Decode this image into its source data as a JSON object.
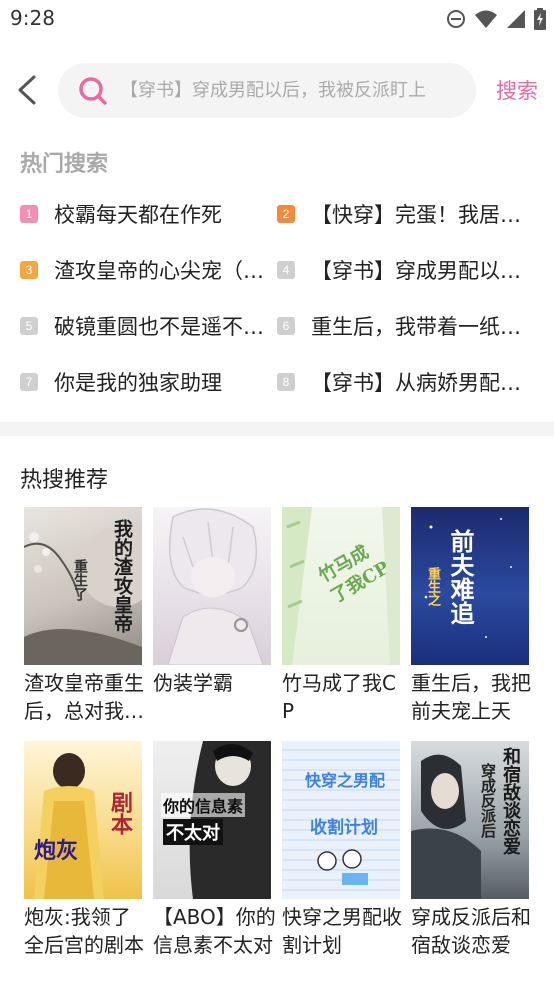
{
  "status_bar": {
    "time": "9:28"
  },
  "search": {
    "placeholder": "【穿书】穿成男配以后，我被反派盯上",
    "submit_label": "搜索"
  },
  "hot_search": {
    "title": "热门搜索",
    "items": [
      {
        "rank": "1",
        "text": "校霸每天都在作死",
        "color": "#f06292"
      },
      {
        "rank": "2",
        "text": "【快穿】完蛋！我居然被盯上了",
        "color": "#f08a3c"
      },
      {
        "rank": "3",
        "text": "渣攻皇帝的心尖宠（重生）",
        "color": "#f5a73b"
      },
      {
        "rank": "4",
        "text": "【穿书】穿成男配以后，我被反派盯上",
        "color": "#c8c8c8"
      },
      {
        "rank": "5",
        "text": "破镜重圆也不是遥不可及",
        "color": "#c8c8c8"
      },
      {
        "rank": "6",
        "text": "重生后，我带着一纸婚书",
        "color": "#c8c8c8"
      },
      {
        "rank": "7",
        "text": "你是我的独家助理",
        "color": "#c8c8c8"
      },
      {
        "rank": "8",
        "text": "【穿书】从病娇男配手里逃生",
        "color": "#c8c8c8"
      }
    ]
  },
  "recommend": {
    "title": "热搜推荐",
    "books": [
      {
        "title": "渣攻皇帝重生后，总对我动心",
        "cover_text": "我的渣攻皇帝",
        "cover_sub": "重生了"
      },
      {
        "title": "伪装学霸",
        "cover_text": "",
        "cover_sub": ""
      },
      {
        "title": "竹马成了我CP",
        "cover_text": "竹马成了我CP",
        "cover_sub": ""
      },
      {
        "title": "重生后，我把前夫宠上天",
        "cover_text": "前夫难追",
        "cover_sub": "重生之"
      },
      {
        "title": "炮灰:我领了全后宫的剧本",
        "cover_text": "炮灰",
        "cover_sub": "剧本"
      },
      {
        "title": "【ABO】你的信息素不太对",
        "cover_text": "你的信息素",
        "cover_sub": "不太对"
      },
      {
        "title": "快穿之男配收割计划",
        "cover_text": "快穿之男配",
        "cover_sub": "收割计划"
      },
      {
        "title": "穿成反派后和宿敌谈恋爱",
        "cover_text": "和宿敌谈恋爱",
        "cover_sub": "穿成反派后"
      }
    ]
  }
}
